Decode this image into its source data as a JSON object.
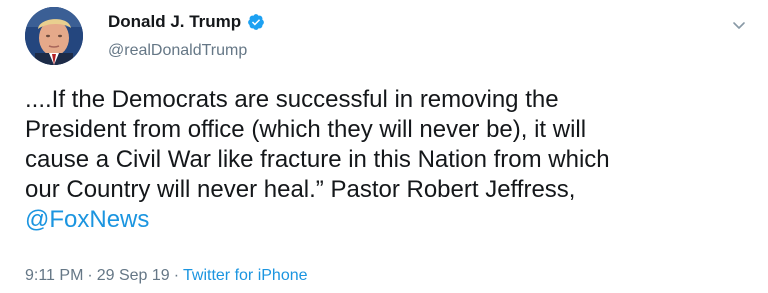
{
  "author": {
    "display_name": "Donald J. Trump",
    "handle": "@realDonaldTrump",
    "avatar_icon": "profile-photo",
    "verified_icon": "verified-badge-icon"
  },
  "menu": {
    "icon": "chevron-down-icon"
  },
  "tweet": {
    "lines": [
      "....If the Democrats are successful in removing the",
      "President from office (which they will never be), it will",
      "cause a Civil War like fracture in this Nation from which",
      "our Country will never heal.” Pastor Robert Jeffress,"
    ],
    "mention": "@FoxNews"
  },
  "meta": {
    "time": "9:11 PM",
    "separator": "·",
    "date": "29 Sep 19",
    "source": "Twitter for iPhone"
  },
  "colors": {
    "link": "#1b95e0",
    "secondary": "#657786",
    "text": "#14171a"
  }
}
